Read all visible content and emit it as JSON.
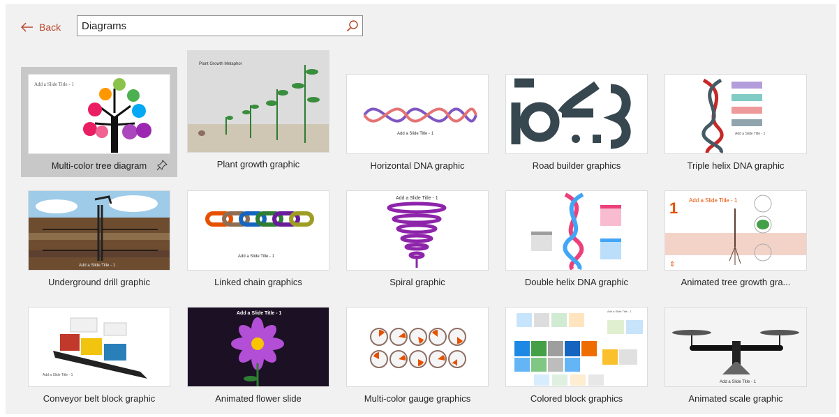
{
  "nav": {
    "back_label": "Back"
  },
  "search": {
    "value": "Diagrams",
    "placeholder": ""
  },
  "thumbnail_text": {
    "slide_title": "Add a Slide Title - 1",
    "plant_metaphor": "Plant Growth Metaphor"
  },
  "cards": [
    {
      "label": "Multi-color tree diagram",
      "icon": "tree-diagram",
      "selected": true
    },
    {
      "label": "Plant growth graphic",
      "icon": "plant-growth"
    },
    {
      "label": "Horizontal DNA graphic",
      "icon": "dna-horizontal"
    },
    {
      "label": "Road builder graphics",
      "icon": "road-builder"
    },
    {
      "label": "Triple helix DNA graphic",
      "icon": "triple-helix"
    },
    {
      "label": "Underground drill graphic",
      "icon": "drill"
    },
    {
      "label": "Linked chain graphics",
      "icon": "chain"
    },
    {
      "label": "Spiral graphic",
      "icon": "spiral"
    },
    {
      "label": "Double helix DNA graphic",
      "icon": "double-helix"
    },
    {
      "label": "Animated tree growth gra...",
      "icon": "tree-growth"
    },
    {
      "label": "Conveyor belt block graphic",
      "icon": "conveyor"
    },
    {
      "label": "Animated flower slide",
      "icon": "flower"
    },
    {
      "label": "Multi-color gauge graphics",
      "icon": "gauges"
    },
    {
      "label": "Colored block graphics",
      "icon": "blocks"
    },
    {
      "label": "Animated scale graphic",
      "icon": "scale"
    }
  ],
  "colors": {
    "accent": "#b7472a",
    "selected_bg": "#c8c8c8",
    "panel_bg": "#f1f1f1"
  }
}
